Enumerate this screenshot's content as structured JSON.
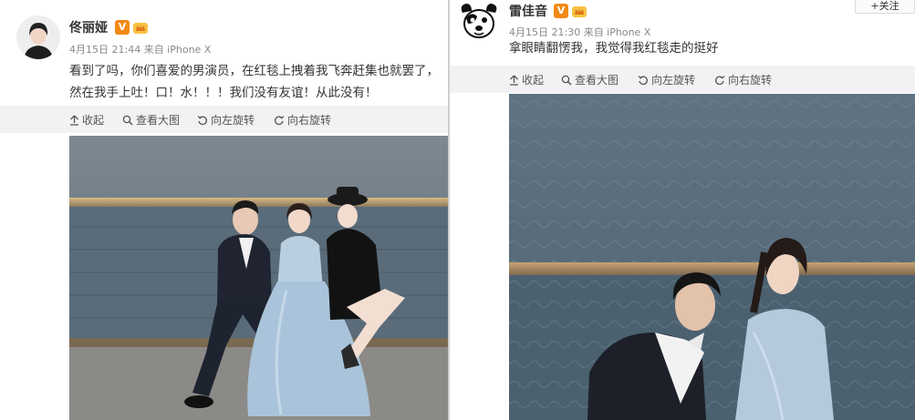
{
  "left_post": {
    "author": "佟丽娅",
    "meta": "4月15日 21:44 来自 iPhone X",
    "text_line1": "看到了吗，你们喜爱的男演员，在红毯上拽着我飞奔赶集也就罢了，",
    "text_line2": "然在我手上吐！口！水！！！我们没有友谊！从此没有！",
    "actions": [
      "收起",
      "查看大图",
      "向左旋转",
      "向右旋转"
    ]
  },
  "right_post": {
    "author": "雷佳音",
    "meta": "4月15日 21:30 来自 iPhone X",
    "text": "拿眼睛翻愣我，我觉得我红毯走的挺好",
    "follow_label": "+关注",
    "actions": [
      "收起",
      "查看大图",
      "向左旋转",
      "向右旋转"
    ]
  },
  "icons": {
    "collapse": "collapse-up-icon",
    "view_large": "magnifier-icon",
    "rotate_left": "rotate-left-icon",
    "rotate_right": "rotate-right-icon",
    "verified": "verified-v-icon",
    "vip": "vip-crown-icon"
  },
  "colors": {
    "badge_orange": "#f28a16",
    "action_bar_bg": "#f2f2f5",
    "meta_gray": "#888888"
  }
}
